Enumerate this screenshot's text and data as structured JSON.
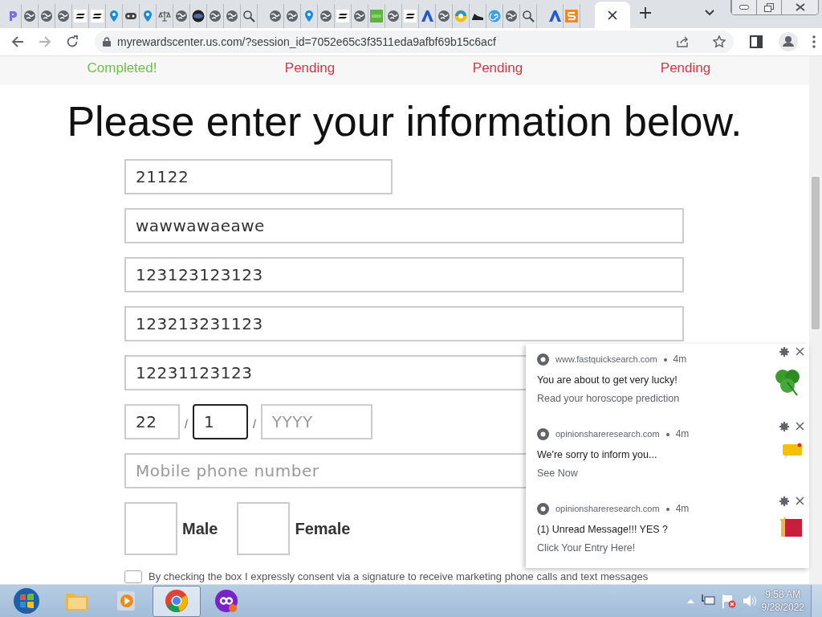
{
  "browser": {
    "tabs": [
      {
        "kind": "p-logo",
        "selected": false
      },
      {
        "kind": "globe",
        "selected": false
      },
      {
        "kind": "globe",
        "selected": false
      },
      {
        "kind": "globe",
        "selected": false
      },
      {
        "kind": "dash",
        "selected": false
      },
      {
        "kind": "dash",
        "selected": false
      },
      {
        "kind": "pin",
        "selected": false
      },
      {
        "kind": "pill",
        "selected": false
      },
      {
        "kind": "pin",
        "selected": false
      },
      {
        "kind": "scales",
        "selected": false
      },
      {
        "kind": "globe",
        "selected": false
      },
      {
        "kind": "dark-globe",
        "selected": false
      },
      {
        "kind": "globe",
        "selected": false
      },
      {
        "kind": "globe",
        "selected": false
      },
      {
        "kind": "search",
        "selected": false
      },
      {
        "kind": "globe",
        "selected": false
      },
      {
        "kind": "globe",
        "selected": false
      },
      {
        "kind": "pin",
        "selected": false
      },
      {
        "kind": "globe",
        "selected": false
      },
      {
        "kind": "dash",
        "selected": false
      },
      {
        "kind": "globe",
        "selected": false
      },
      {
        "kind": "green-square",
        "selected": false
      },
      {
        "kind": "globe",
        "selected": false
      },
      {
        "kind": "dash",
        "selected": false
      },
      {
        "kind": "a-logo",
        "selected": false
      },
      {
        "kind": "globe",
        "selected": false
      },
      {
        "kind": "e-logo",
        "selected": false
      },
      {
        "kind": "shoe",
        "selected": false
      },
      {
        "kind": "swirl",
        "selected": false
      },
      {
        "kind": "globe",
        "selected": false
      },
      {
        "kind": "search",
        "selected": false
      },
      {
        "kind": "a-logo",
        "selected": false
      },
      {
        "kind": "s-logo",
        "selected": false
      },
      {
        "kind": "blank",
        "selected": true
      }
    ],
    "url": "myrewardscenter.us.com/?session_id=7052e65c3f3511eda9afbf69b15c6acf"
  },
  "progress": [
    {
      "label": "Completed!",
      "kind": "done"
    },
    {
      "label": "Pending",
      "kind": "todo"
    },
    {
      "label": "Pending",
      "kind": "todo"
    },
    {
      "label": "Pending",
      "kind": "todo"
    }
  ],
  "heading": "Please enter your information below.",
  "fields": [
    {
      "value": "21122",
      "kind": "short"
    },
    {
      "value": "wawwawaeawe",
      "kind": "wide"
    },
    {
      "value": "123123123123",
      "kind": "wide"
    },
    {
      "value": "123213231123",
      "kind": "wide"
    },
    {
      "value": "12231123123",
      "kind": "wide"
    }
  ],
  "birth_date": {
    "parts": [
      {
        "value": "22",
        "focused": false
      },
      {
        "value": "1",
        "focused": true
      },
      {
        "placeholder": "YYYY",
        "focused": false
      }
    ],
    "separators": [
      "/",
      "/"
    ]
  },
  "phone": {
    "placeholder": "Mobile phone number"
  },
  "gender": [
    {
      "label": "Male",
      "checked": false
    },
    {
      "label": "Female",
      "checked": false
    }
  ],
  "consent": {
    "text": "By checking the box I expressly consent via a signature to receive marketing phone calls and text messages",
    "checked": false
  },
  "notifications": [
    {
      "source": "www.fastquicksearch.com",
      "time": "4m",
      "title": "You are about to get very lucky!",
      "body": "Read your horoscope prediction",
      "kind": "clover"
    },
    {
      "source": "opinionshareresearch.com",
      "time": "4m",
      "title": "We're sorry to inform you...",
      "body": "See Now",
      "kind": "message"
    },
    {
      "source": "opinionshareresearch.com",
      "time": "4m",
      "title": "(1) Unread Message!!! YES ?",
      "body": "Click Your Entry Here!",
      "kind": "gift"
    }
  ],
  "taskbar": {
    "apps": [
      {
        "kind": "folder",
        "selected": false
      },
      {
        "kind": "media",
        "selected": false
      },
      {
        "kind": "chrome",
        "selected": true
      },
      {
        "kind": "infinity",
        "selected": false
      }
    ],
    "time": "9:58 AM",
    "date": "9/28/2022"
  }
}
